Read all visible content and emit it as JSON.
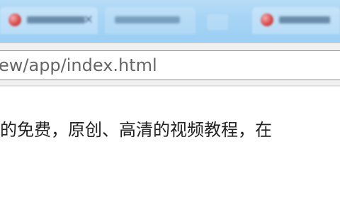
{
  "browser": {
    "address_bar": {
      "url_fragment": "ew/app/index.html"
    },
    "tabs": [
      {
        "icon": "globe-icon"
      },
      {
        "icon": "none"
      },
      {
        "icon": "globe-icon"
      }
    ]
  },
  "content": {
    "paragraph": "的免费，原创、高清的视频教程，在"
  },
  "colors": {
    "tabbar": "#a6d4f5",
    "toolbar": "#f0f0f0",
    "page_background": "#ffffff",
    "text": "#222222",
    "url_text": "#666666"
  }
}
